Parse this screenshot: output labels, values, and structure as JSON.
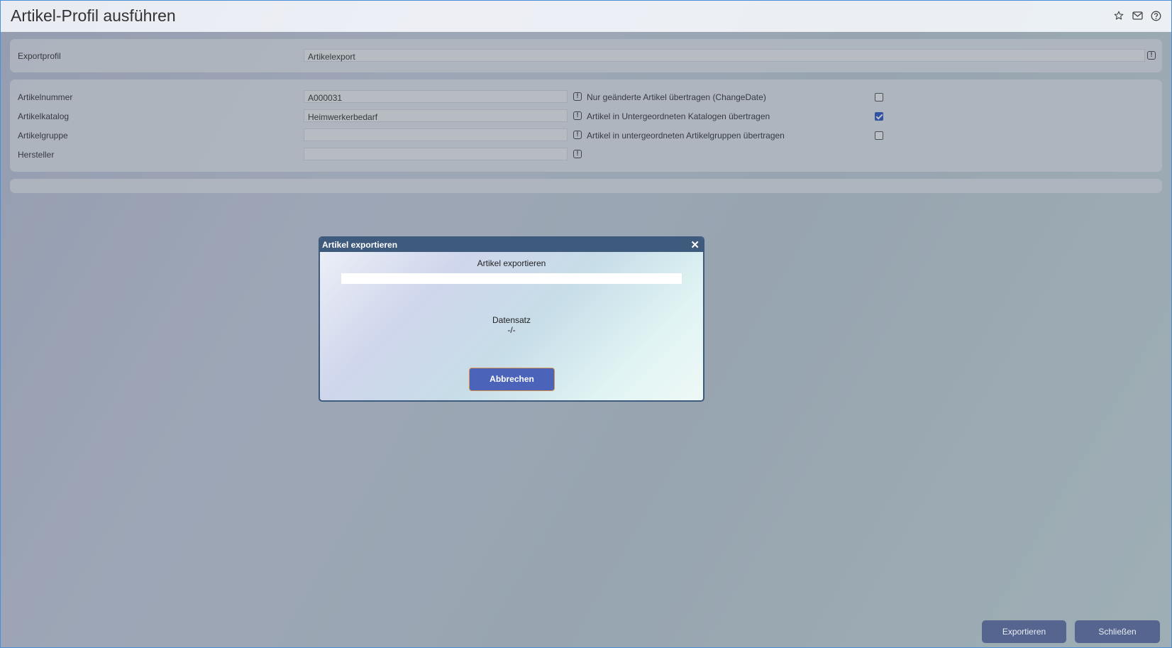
{
  "page": {
    "title": "Artikel-Profil ausführen"
  },
  "header_icons": [
    "star-icon",
    "mail-icon",
    "help-icon"
  ],
  "profile": {
    "label": "Exportprofil",
    "value": "Artikelexport"
  },
  "fields": [
    {
      "label": "Artikelnummer",
      "value": "A000031"
    },
    {
      "label": "Artikelkatalog",
      "value": "Heimwerkerbedarf"
    },
    {
      "label": "Artikelgruppe",
      "value": ""
    },
    {
      "label": "Hersteller",
      "value": ""
    }
  ],
  "options": [
    {
      "label": "Nur geänderte Artikel übertragen (ChangeDate)",
      "checked": false
    },
    {
      "label": "Artikel in Untergeordneten Katalogen übertragen",
      "checked": true
    },
    {
      "label": "Artikel in untergeordneten Artikelgruppen übertragen",
      "checked": false
    }
  ],
  "dialog": {
    "title": "Artikel exportieren",
    "heading": "Artikel exportieren",
    "progress": 0,
    "record_label": "Datensatz",
    "record_value": "-/-",
    "cancel_label": "Abbrechen"
  },
  "footer": {
    "export_label": "Exportieren",
    "close_label": "Schließen"
  },
  "colors": {
    "accent": "#4b63b8",
    "dialog_header": "#3e5a7d",
    "footer_button": "#55658f",
    "checkbox_checked": "#2f55c9"
  }
}
